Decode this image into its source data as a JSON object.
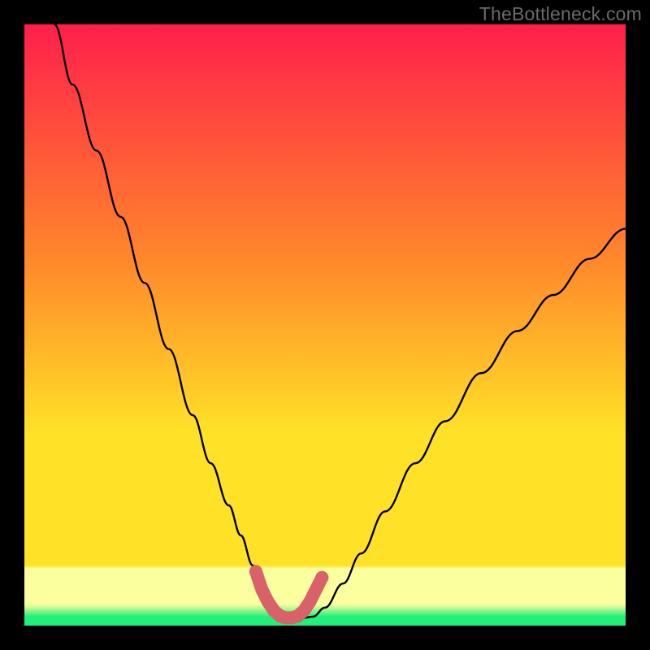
{
  "watermark": "TheBottleneck.com",
  "colors": {
    "background": "#000000",
    "gradient_top": "#ff1f4b",
    "gradient_mid_upper": "#ff8a2a",
    "gradient_mid": "#ffe228",
    "gradient_low_band": "#fbff9e",
    "gradient_bottom": "#22f07a",
    "curve": "#000000",
    "marker": "#d9616a"
  },
  "chart_data": {
    "type": "line",
    "title": "",
    "xlabel": "",
    "ylabel": "",
    "xlim": [
      0,
      100
    ],
    "ylim": [
      0,
      100
    ],
    "series": [
      {
        "name": "bottleneck-curve",
        "x": [
          5,
          8,
          12,
          16,
          20,
          24,
          28,
          31,
          34,
          36,
          38,
          40,
          42,
          44,
          46,
          48,
          50,
          53,
          56,
          60,
          65,
          70,
          76,
          82,
          88,
          94,
          100
        ],
        "y": [
          100,
          90,
          79,
          68,
          57,
          46,
          35,
          27,
          20,
          15,
          10,
          6,
          3,
          1.5,
          1.2,
          1.5,
          3,
          7,
          12,
          19,
          27,
          34,
          42,
          49,
          55,
          61,
          66
        ]
      }
    ],
    "markers": {
      "name": "minimum-band",
      "x": [
        38.5,
        39.5,
        40.5,
        41.5,
        42.5,
        43.5,
        44.5,
        45.5,
        46.5,
        47.5,
        48.5,
        49.5
      ],
      "y": [
        9,
        6,
        4,
        2.5,
        1.6,
        1.3,
        1.3,
        1.6,
        2.5,
        4,
        6,
        8
      ]
    }
  }
}
